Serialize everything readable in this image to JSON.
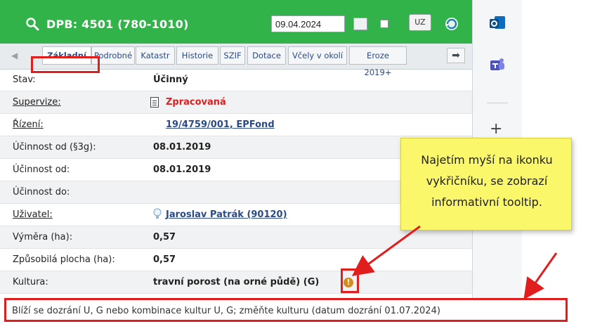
{
  "header": {
    "title": "DPB: 4501 (780-1010)",
    "date_value": "09.04.2024",
    "uz_label": "UZ"
  },
  "tabs": [
    {
      "label": "Základní"
    },
    {
      "label": "Podrobné"
    },
    {
      "label": "Katastr"
    },
    {
      "label": "Historie"
    },
    {
      "label": "SZIF"
    },
    {
      "label": "Dotace"
    },
    {
      "label": "Včely v okolí"
    },
    {
      "label": "Eroze 2019+"
    }
  ],
  "fields": {
    "stav": {
      "label": "Stav:",
      "value": "Účinný"
    },
    "supervize": {
      "label": "Supervize:",
      "value": "Zpracovaná"
    },
    "rizeni": {
      "label": "Řízení:",
      "value": "19/4759/001, EPFond"
    },
    "ucinnost_3g": {
      "label": "Účinnost od (§3g):",
      "value": "08.01.2019"
    },
    "ucinnost_od": {
      "label": "Účinnost od:",
      "value": "08.01.2019"
    },
    "ucinnost_do": {
      "label": "Účinnost do:",
      "value": ""
    },
    "uzivatel": {
      "label": "Uživatel:",
      "value": "Jaroslav Patrák (90120)"
    },
    "vymera": {
      "label": "Výměra (ha):",
      "value": "0,57"
    },
    "zpusobila": {
      "label": "Způsobilá plocha (ha):",
      "value": "0,57"
    },
    "kultura": {
      "label": "Kultura:",
      "value": "travní porost (na orné půdě) (G)"
    }
  },
  "warning_icon_glyph": "!",
  "tooltip_text": "Blíží se dozrání U, G nebo kombinace kultur U, G; změňte kulturu (datum dozrání 01.07.2024)",
  "callout": {
    "text": "Najetím myší na ikonku vykřičníku, se zobrazí informativní tooltip."
  },
  "rail": {
    "icons": [
      "outlook-icon",
      "teams-icon",
      "plus-icon"
    ]
  },
  "colors": {
    "header_green": "#32b34a",
    "highlight_red": "#e11e1e",
    "callout_yellow": "#fbf76a",
    "link_blue": "#2b4b88",
    "status_red": "#e02020",
    "warning_orange": "#d68b1d"
  }
}
